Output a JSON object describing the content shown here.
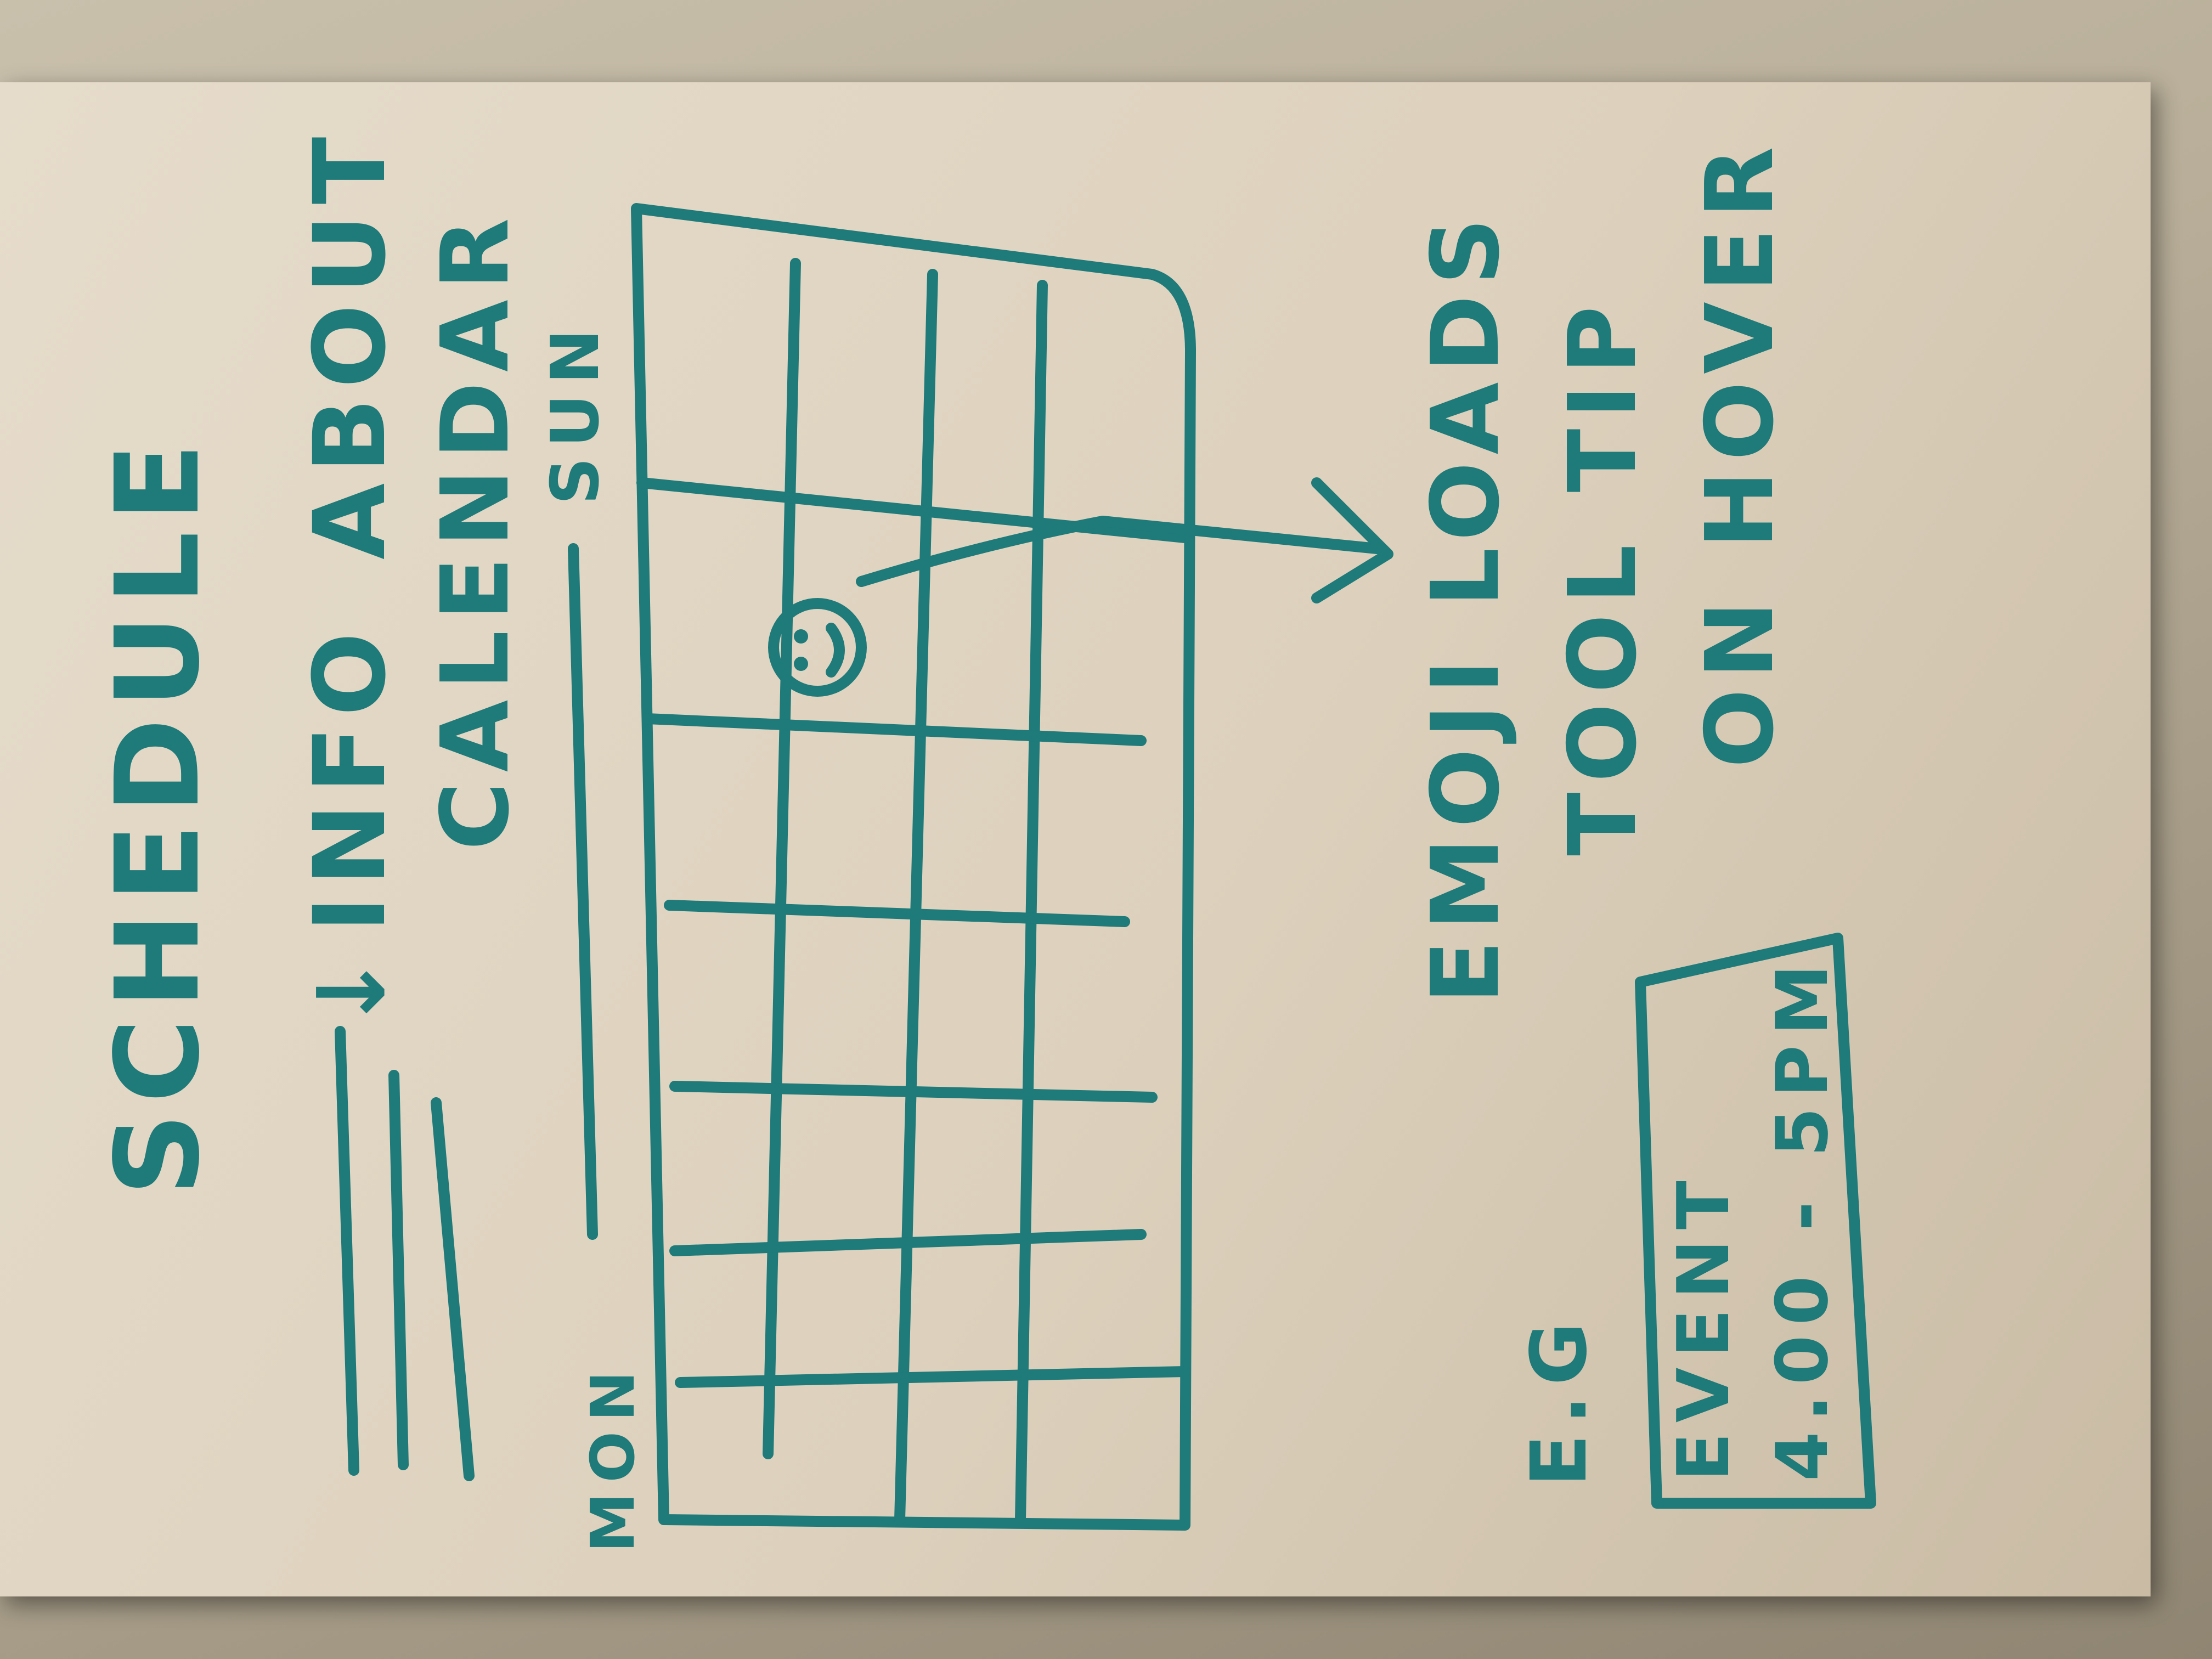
{
  "sketch": {
    "title": "SCHEDULE",
    "nav": {
      "arrow": "↓",
      "info_label": "INFO",
      "about_label": "ABOUT",
      "calendar_label": "CALENDAR"
    },
    "calendar": {
      "day_start": "MON",
      "day_end": "SUN"
    },
    "annotation": {
      "line1": "EMOJI LOADS",
      "line2": "TOOL TIP",
      "line3": "ON HOVER"
    },
    "example": {
      "prefix": "E.G",
      "event_title": "EVENT",
      "event_time": "4.00 - 5PM"
    },
    "icons": {
      "emoji": "smiley-face",
      "menu": "hamburger-lines"
    },
    "colors": {
      "ink": "#1f7a7a",
      "paper": "#e6dccb"
    }
  }
}
